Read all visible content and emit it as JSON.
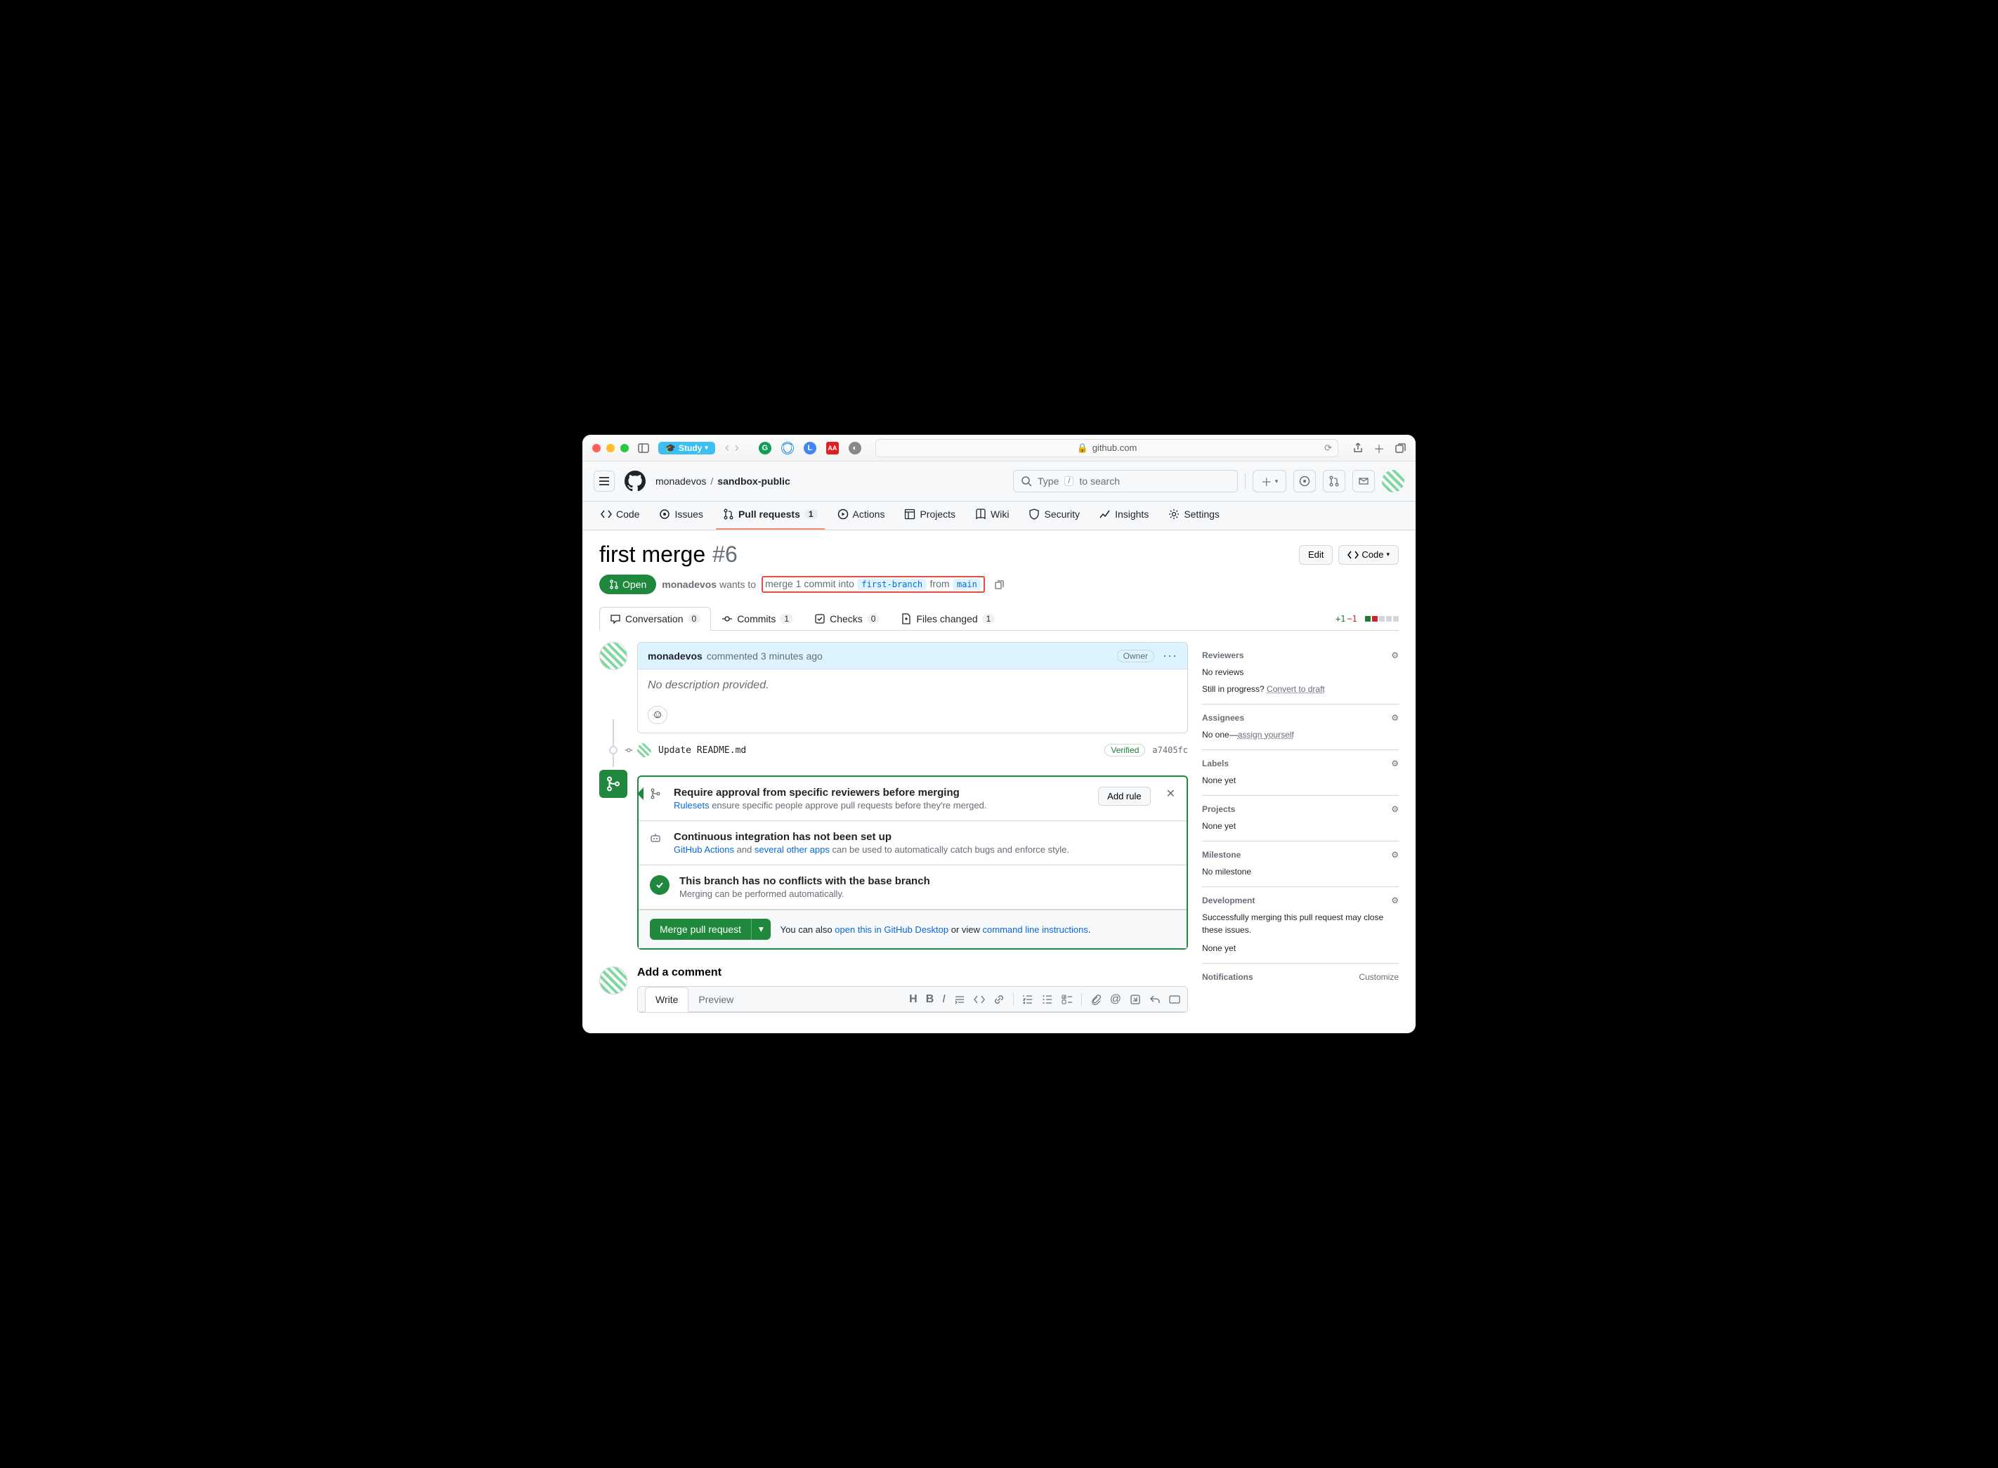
{
  "browser": {
    "study_label": "Study",
    "url_host": "github.com"
  },
  "header": {
    "owner": "monadevos",
    "repo": "sandbox-public",
    "search_placeholder": "Type",
    "search_hint": "to search",
    "search_key": "/"
  },
  "repo_tabs": {
    "code": "Code",
    "issues": "Issues",
    "pulls": "Pull requests",
    "pulls_count": "1",
    "actions": "Actions",
    "projects": "Projects",
    "wiki": "Wiki",
    "security": "Security",
    "insights": "Insights",
    "settings": "Settings"
  },
  "pr": {
    "title": "first merge",
    "number": "#6",
    "edit": "Edit",
    "code": "Code",
    "state": "Open",
    "author": "monadevos",
    "wants": "wants to",
    "merge_text": "merge 1 commit into",
    "base_branch": "first-branch",
    "from": "from",
    "head_branch": "main"
  },
  "pr_tabs": {
    "conversation": "Conversation",
    "conversation_count": "0",
    "commits": "Commits",
    "commits_count": "1",
    "checks": "Checks",
    "checks_count": "0",
    "files": "Files changed",
    "files_count": "1",
    "additions": "+1",
    "deletions": "−1"
  },
  "comment": {
    "author": "monadevos",
    "action": "commented",
    "time": "3 minutes ago",
    "owner_label": "Owner",
    "body": "No description provided."
  },
  "commit": {
    "msg": "Update README.md",
    "verified": "Verified",
    "sha": "a7405fc"
  },
  "merge": {
    "rule_title": "Require approval from specific reviewers before merging",
    "rule_link": "Rulesets",
    "rule_text": " ensure specific people approve pull requests before they're merged.",
    "add_rule": "Add rule",
    "ci_title": "Continuous integration has not been set up",
    "ci_link1": "GitHub Actions",
    "ci_and": " and ",
    "ci_link2": "several other apps",
    "ci_text": " can be used to automatically catch bugs and enforce style.",
    "ok_title": "This branch has no conflicts with the base branch",
    "ok_text": "Merging can be performed automatically.",
    "button": "Merge pull request",
    "also": "You can also ",
    "desktop": "open this in GitHub Desktop",
    "or": " or view ",
    "cmdline": "command line instructions",
    "dot": "."
  },
  "editor": {
    "heading": "Add a comment",
    "write": "Write",
    "preview": "Preview"
  },
  "sidebar": {
    "reviewers": {
      "title": "Reviewers",
      "text": "No reviews",
      "progress": "Still in progress? ",
      "convert": "Convert to draft"
    },
    "assignees": {
      "title": "Assignees",
      "text": "No one—",
      "assign": "assign yourself"
    },
    "labels": {
      "title": "Labels",
      "text": "None yet"
    },
    "projects": {
      "title": "Projects",
      "text": "None yet"
    },
    "milestone": {
      "title": "Milestone",
      "text": "No milestone"
    },
    "development": {
      "title": "Development",
      "text": "Successfully merging this pull request may close these issues.",
      "none": "None yet"
    },
    "notifications": {
      "title": "Notifications",
      "customize": "Customize"
    }
  }
}
